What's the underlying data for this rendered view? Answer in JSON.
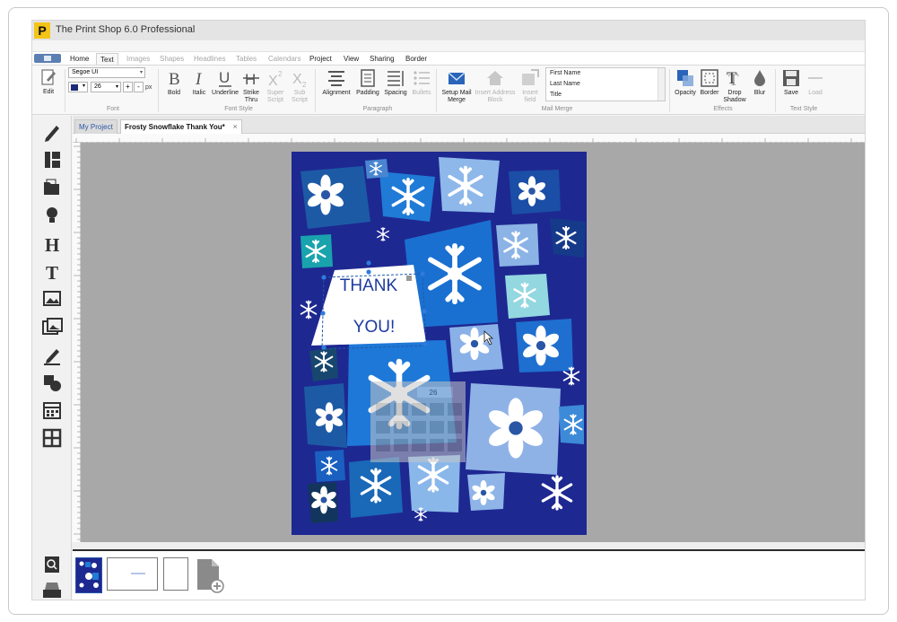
{
  "app": {
    "title": "The Print Shop 6.0 Professional",
    "logo_letter": "P"
  },
  "menu_tabs": [
    {
      "label": "Home",
      "state": "normal"
    },
    {
      "label": "Text",
      "state": "active"
    },
    {
      "label": "Images",
      "state": "dim"
    },
    {
      "label": "Shapes",
      "state": "dim"
    },
    {
      "label": "Headlines",
      "state": "dim"
    },
    {
      "label": "Tables",
      "state": "dim"
    },
    {
      "label": "Calendars",
      "state": "dim"
    },
    {
      "label": "Project",
      "state": "normal"
    },
    {
      "label": "View",
      "state": "normal"
    },
    {
      "label": "Sharing",
      "state": "normal"
    },
    {
      "label": "Border",
      "state": "normal"
    }
  ],
  "ribbon": {
    "edit_label": "Edit",
    "font": {
      "family": "Segoe UI",
      "size": "26",
      "increase": "+",
      "decrease": "-",
      "unit": "px",
      "group_label": "Font"
    },
    "font_style": {
      "group_label": "Font Style",
      "bold": "Bold",
      "italic": "Italic",
      "underline": "Underline",
      "strike": "Strike Thru",
      "superscript": "Super Script",
      "subscript": "Sub Script"
    },
    "paragraph": {
      "group_label": "Paragraph",
      "alignment": "Alignment",
      "padding": "Padding",
      "spacing": "Spacing",
      "bullets": "Bullets"
    },
    "mail_merge": {
      "group_label": "Mail Merge",
      "setup": "Setup Mail Merge",
      "insert_address": "Insert Address Block",
      "insert_field": "Insert field",
      "fields": [
        "First Name",
        "Last Name",
        "Title"
      ]
    },
    "effects": {
      "group_label": "Effects",
      "opacity": "Opacity",
      "border": "Border",
      "drop_shadow": "Drop Shadow",
      "blur": "Blur"
    },
    "text_style": {
      "group_label": "Text Style",
      "save": "Save",
      "load": "Load"
    }
  },
  "documents": {
    "tab_1": "My Project",
    "tab_2": "Frosty Snowflake Thank You*",
    "close": "×"
  },
  "card": {
    "line_1": "THANK",
    "line_2": "YOU!",
    "float_size": "26"
  },
  "colors": {
    "card_bg": "#1e2891",
    "accent": "#2a56a6",
    "canvas": "#a8a8a8"
  },
  "left_tools": [
    "pencil-icon",
    "layout-icon",
    "folder-icon",
    "lightbulb-icon",
    "headline-icon",
    "text-icon",
    "image-icon",
    "photos-icon",
    "edit-icon",
    "shapes-icon",
    "calendar-icon",
    "table-icon",
    "search-icon",
    "tray-icon"
  ]
}
